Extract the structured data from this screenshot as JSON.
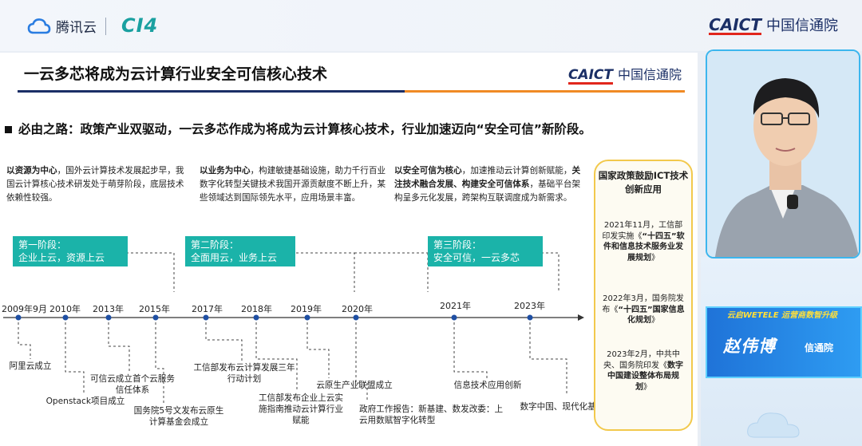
{
  "header": {
    "tencent_cloud_label": "腾讯云",
    "event_logo": "CI4",
    "caict_en": "CAICT",
    "caict_cn": "中国信通院"
  },
  "slide": {
    "title": "一云多芯将成为云计算行业安全可信核心技术",
    "logo_en": "CAICT",
    "logo_cn": "中国信通院",
    "headline": "必由之路：政策产业双驱动，一云多芯作成为将成为云计算核心技术，行业加速迈向“安全可信”新阶段。",
    "descriptions": [
      {
        "bold": "以资源为中心",
        "text": "，国外云计算技术发展起步早，我国云计算核心技术研发处于萌芽阶段，底层技术依赖性较强。"
      },
      {
        "bold": "以业务为中心",
        "text": "，构建敏捷基础设施，助力千行百业数字化转型关键技术我国开源贡献度不断上升，某些领域达到国际领先水平，应用场景丰富。"
      },
      {
        "bold": "以安全可信为核心",
        "text": "，加速推动云计算创新赋能，",
        "bold2": "关注技术融合发展、构建安全可信体系",
        "text2": "，基础平台架构呈多元化发展，跨架构互联调度成为新需求。"
      }
    ],
    "stages": [
      {
        "line1": "第一阶段：",
        "line2": "企业上云，资源上云"
      },
      {
        "line1": "第二阶段：",
        "line2": "全面用云，业务上云"
      },
      {
        "line1": "第三阶段：",
        "line2": "安全可信，一云多芯"
      }
    ],
    "years": [
      "2009年9月",
      "2010年",
      "2013年",
      "2015年",
      "2017年",
      "2018年",
      "2019年",
      "2020年",
      "2021年",
      "2023年"
    ],
    "events": [
      "阿里云成立",
      "Openstack项目成立",
      "可信云成立首个云服务信任体系",
      "国务院5号文发布云原生计算基金会成立",
      "工信部发布云计算发展三年行动计划",
      "工信部发布企业上云实施指南推动云计算行业赋能",
      "云原生产业联盟成立",
      "政府工作报告：新基建、数发改委：上云用数赋智字化转型",
      "信息技术应用创新",
      "数字中国、现代化基础设施"
    ],
    "policy": {
      "title": "国家政策鼓励ICT技术创新应用",
      "items": [
        {
          "text": "2021年11月，工信部印发实施《",
          "bold": "“十四五”软件和信息技术服务业发展规划",
          "tail": "》"
        },
        {
          "text": "2022年3月，国务院发布《",
          "bold": "“十四五”国家信息化规划",
          "tail": "》"
        },
        {
          "text": "2023年2月，中共中央、国务院印发《",
          "bold": "数字中国建设整体布局规划",
          "tail": "》"
        }
      ]
    }
  },
  "speaker": {
    "banner": "云启WETELE  运营商数智升级",
    "name": "赵伟博",
    "org": "信通院"
  },
  "colors": {
    "stage_teal": "#1bb3a9",
    "caict_navy": "#1b2f66",
    "accent_orange": "#f08a24",
    "policy_border": "#f2c94c"
  }
}
